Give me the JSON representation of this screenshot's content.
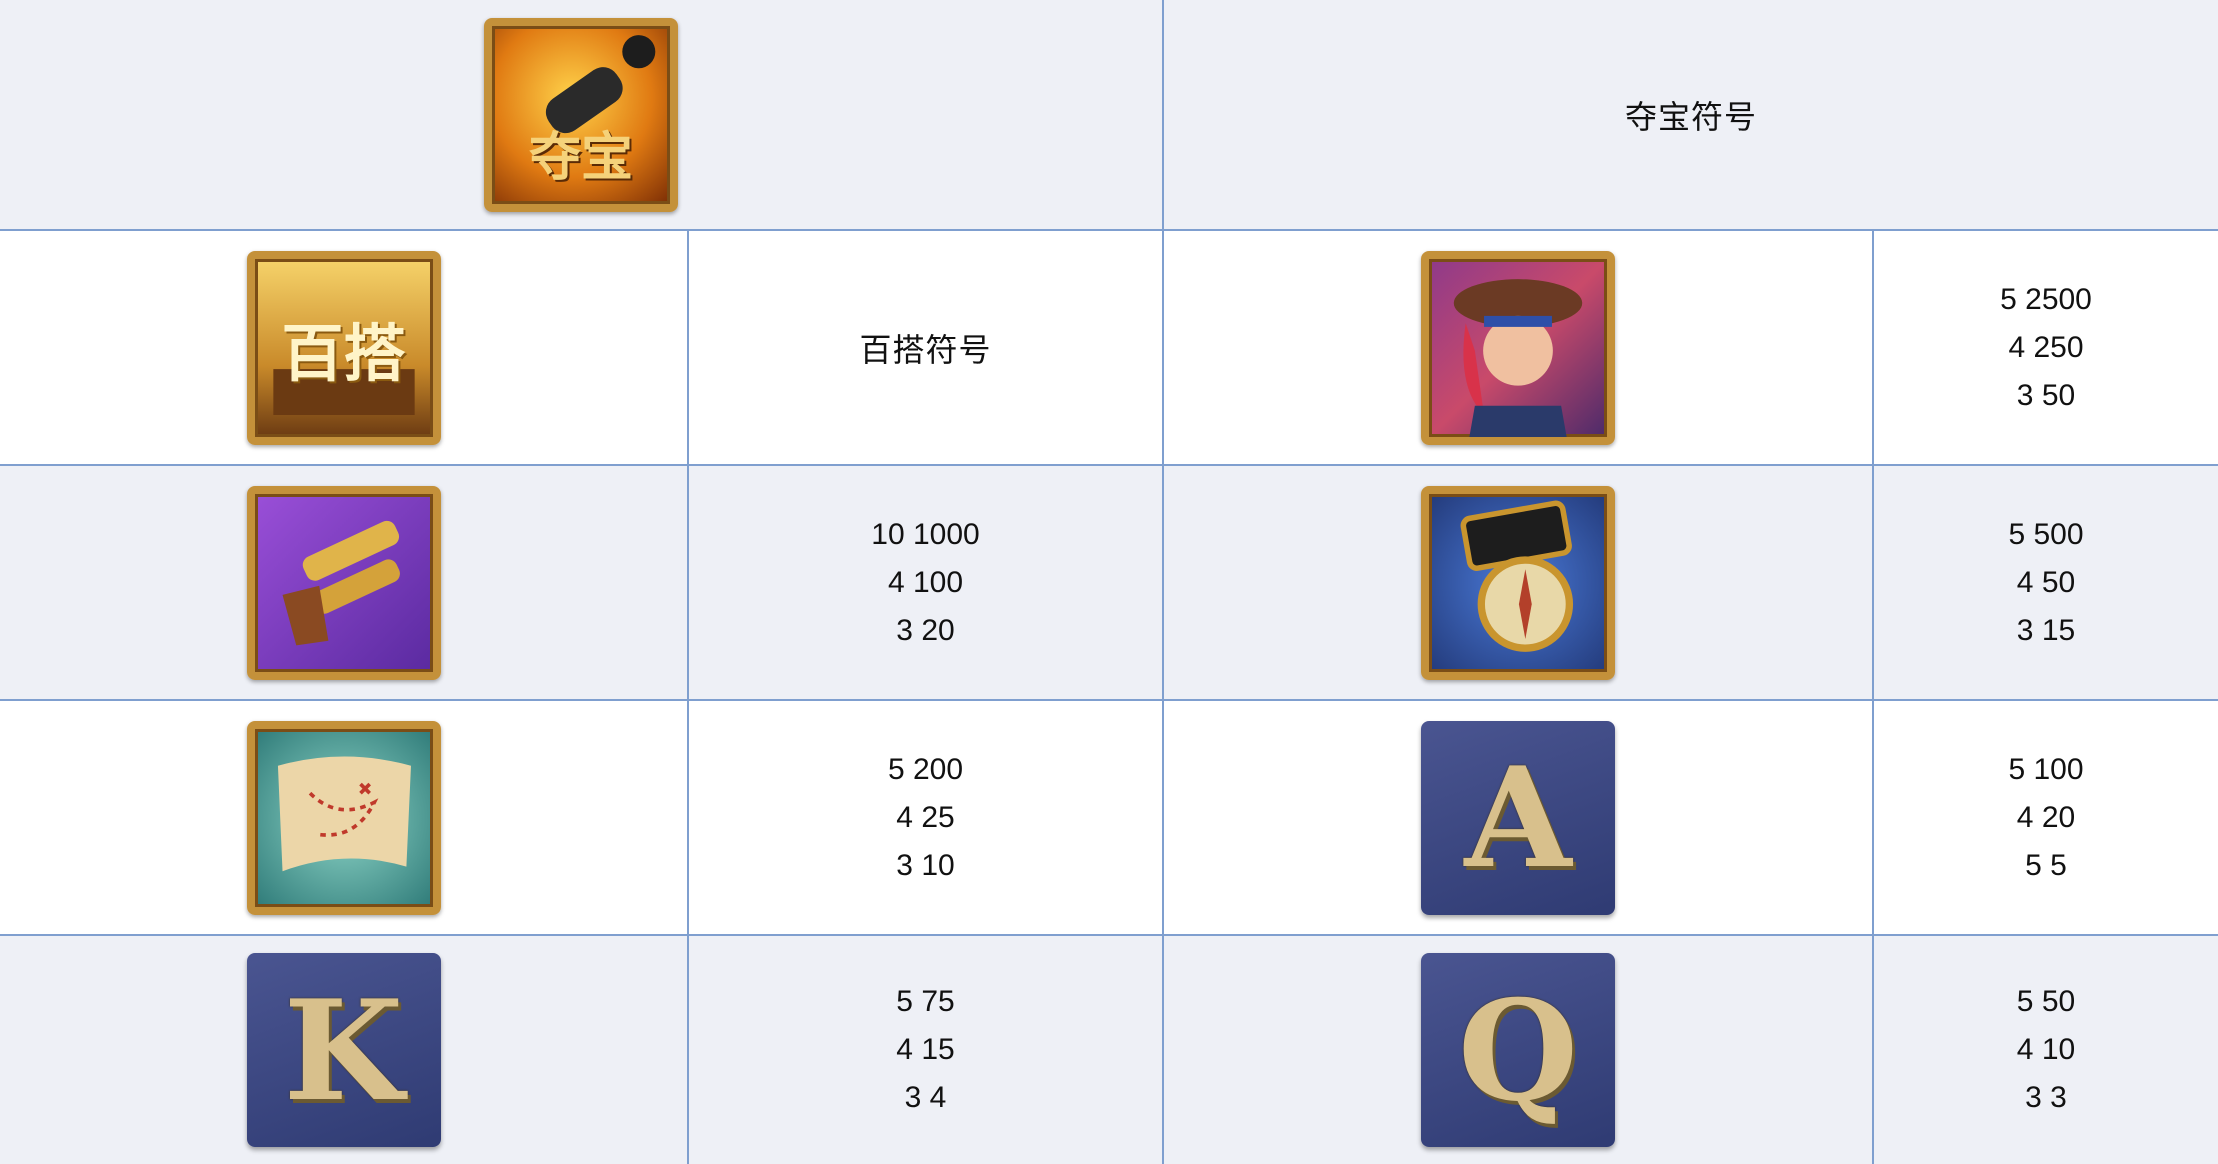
{
  "header_row": {
    "symbol_icon": "cannon-scatter-icon",
    "symbol_text": "夺宝",
    "description": "夺宝符号"
  },
  "rows": [
    {
      "left": {
        "icon": "treasure-chest-wild-icon",
        "icon_text": "百搭",
        "label": "百搭符号"
      },
      "right": {
        "icon": "pirate-woman-icon",
        "payouts": [
          "5 2500",
          "4 250",
          "3 50"
        ]
      }
    },
    {
      "left": {
        "icon": "golden-pistol-icon",
        "payouts": [
          "10 1000",
          "4 100",
          "3 20"
        ]
      },
      "right": {
        "icon": "compass-icon",
        "payouts": [
          "5 500",
          "4 50",
          "3 15"
        ]
      }
    },
    {
      "left": {
        "icon": "treasure-map-icon",
        "payouts": [
          "5 200",
          "4 25",
          "3 10"
        ]
      },
      "right": {
        "icon": "letter-a-icon",
        "letter": "A",
        "payouts": [
          "5 100",
          "4 20",
          "5 5"
        ]
      }
    },
    {
      "left": {
        "icon": "letter-k-icon",
        "letter": "K",
        "payouts": [
          "5 75",
          "4 15",
          "3 4"
        ]
      },
      "right": {
        "icon": "letter-q-icon",
        "letter": "Q",
        "payouts": [
          "5 50",
          "4 10",
          "3 3"
        ]
      }
    }
  ],
  "colors": {
    "grid_line": "#7f9fcf",
    "row_alt": "#eef0f6",
    "gold_frame": "#c4913a",
    "navy_tile": "#3a4580"
  }
}
